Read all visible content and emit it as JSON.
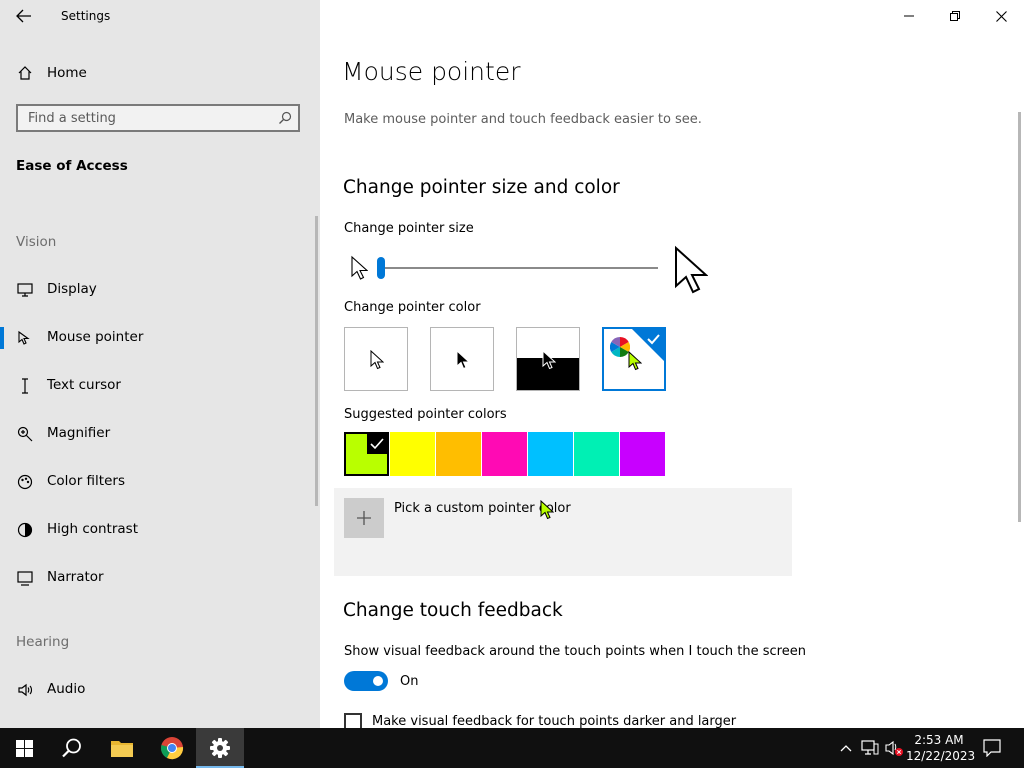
{
  "app": {
    "title": "Settings"
  },
  "sidebar": {
    "home_label": "Home",
    "search": {
      "placeholder": "Find a setting"
    },
    "section_title": "Ease of Access",
    "vision_label": "Vision",
    "vision_items": [
      {
        "label": "Display",
        "icon": "monitor-icon"
      },
      {
        "label": "Mouse pointer",
        "icon": "mouse-pointer-icon",
        "active": true
      },
      {
        "label": "Text cursor",
        "icon": "text-cursor-icon"
      },
      {
        "label": "Magnifier",
        "icon": "magnifier-icon"
      },
      {
        "label": "Color filters",
        "icon": "color-filters-icon"
      },
      {
        "label": "High contrast",
        "icon": "high-contrast-icon"
      },
      {
        "label": "Narrator",
        "icon": "narrator-icon"
      }
    ],
    "hearing_label": "Hearing",
    "hearing_items": [
      {
        "label": "Audio",
        "icon": "audio-icon"
      }
    ]
  },
  "main": {
    "title": "Mouse pointer",
    "subtitle": "Make mouse pointer and touch feedback easier to see.",
    "size_color_heading": "Change pointer size and color",
    "pointer_size_label": "Change pointer size",
    "pointer_size_value": 1,
    "pointer_color_label": "Change pointer color",
    "pointer_color_options": [
      "white",
      "black",
      "inverted",
      "custom"
    ],
    "pointer_color_selected": "custom",
    "suggested_colors_label": "Suggested pointer colors",
    "suggested_colors": [
      "#b9ff00",
      "#ffff00",
      "#ffbe00",
      "#ff0ab4",
      "#00c0ff",
      "#00f0b4",
      "#c800ff"
    ],
    "suggested_selected": "#b9ff00",
    "custom_color_label": "Pick a custom pointer color",
    "touch_heading": "Change touch feedback",
    "touch_feedback_label": "Show visual feedback around the touch points when I touch the screen",
    "touch_toggle_state": "On",
    "darker_larger_label": "Make visual feedback for touch points darker and larger"
  },
  "taskbar": {
    "time": "2:53 AM",
    "date": "12/22/2023"
  },
  "colors": {
    "accent": "#0078d7",
    "sidebar_bg": "#e6e6e6",
    "taskbar_bg": "#101010"
  }
}
